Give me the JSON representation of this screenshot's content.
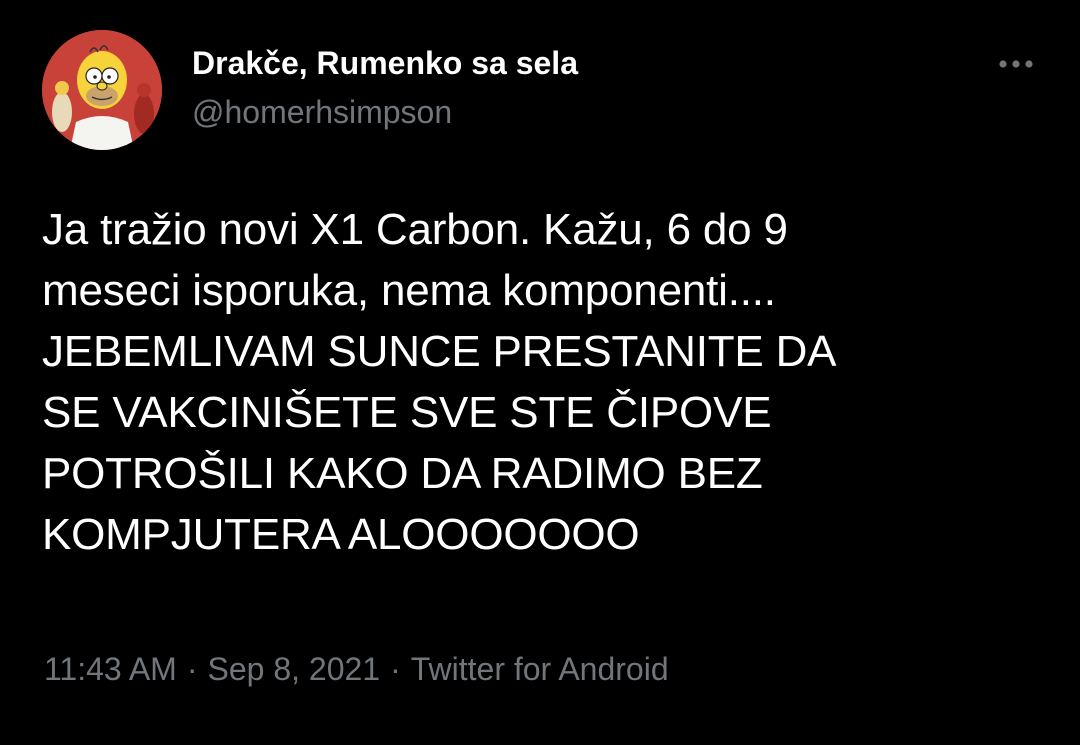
{
  "author": {
    "display_name": "Drakče, Rumenko sa sela",
    "handle": "@homerhsimpson",
    "avatar_icon": "homer-simpson-avatar"
  },
  "more_icon": "more-options-icon",
  "tweet": {
    "lines": [
      "Ja tražio novi X1 Carbon. Kažu, 6 do 9",
      "meseci isporuka, nema komponenti....",
      "JEBEMLIVAM SUNCE PRESTANITE DA",
      "SE VAKCINIŠETE SVE STE ČIPOVE",
      "POTROŠILI KAKO DA RADIMO BEZ",
      "KOMPJUTERA ALOOOOOOO"
    ]
  },
  "meta": {
    "time": "11:43 AM",
    "date": "Sep 8, 2021",
    "separator": "·",
    "source": "Twitter for Android"
  },
  "colors": {
    "background": "#000000",
    "primary_text": "#ffffff",
    "secondary_text": "#71767b",
    "avatar_bg": "#c9423a"
  }
}
